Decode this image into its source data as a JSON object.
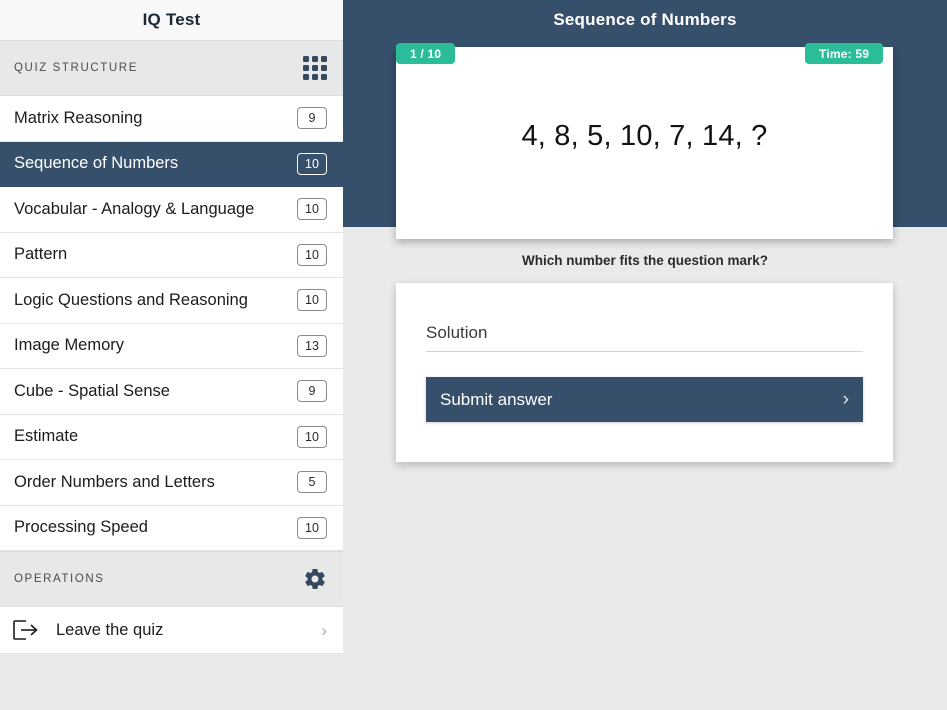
{
  "sidebar": {
    "app_title": "IQ Test",
    "structure_section": {
      "label": "QUIZ STRUCTURE",
      "icon": "grid-icon"
    },
    "categories": [
      {
        "name": "Matrix Reasoning",
        "count": "9",
        "active": false
      },
      {
        "name": "Sequence of Numbers",
        "count": "10",
        "active": true
      },
      {
        "name": "Vocabular - Analogy & Language",
        "count": "10",
        "active": false
      },
      {
        "name": "Pattern",
        "count": "10",
        "active": false
      },
      {
        "name": "Logic Questions and Reasoning",
        "count": "10",
        "active": false
      },
      {
        "name": "Image Memory",
        "count": "13",
        "active": false
      },
      {
        "name": "Cube - Spatial Sense",
        "count": "9",
        "active": false
      },
      {
        "name": "Estimate",
        "count": "10",
        "active": false
      },
      {
        "name": "Order Numbers and Letters",
        "count": "5",
        "active": false
      },
      {
        "name": "Processing Speed",
        "count": "10",
        "active": false
      }
    ],
    "operations_section": {
      "label": "OPERATIONS",
      "icon": "gear-icon"
    },
    "operations": [
      {
        "name": "Leave the quiz",
        "icon": "exit-icon",
        "chevron": "›"
      }
    ]
  },
  "main": {
    "title": "Sequence of Numbers",
    "progress_badge": "1 / 10",
    "timer_badge": "Time: 59",
    "question": "4, 8, 5, 10, 7, 14, ?",
    "prompt": "Which number fits the question mark?",
    "answer": {
      "input_placeholder": "Solution",
      "input_value": "",
      "submit_label": "Submit answer",
      "submit_chevron": "›"
    }
  },
  "colors": {
    "navy": "#364f6b",
    "teal": "#2bbd9a",
    "page_bg": "#eaeaea",
    "card_bg": "#ffffff"
  }
}
